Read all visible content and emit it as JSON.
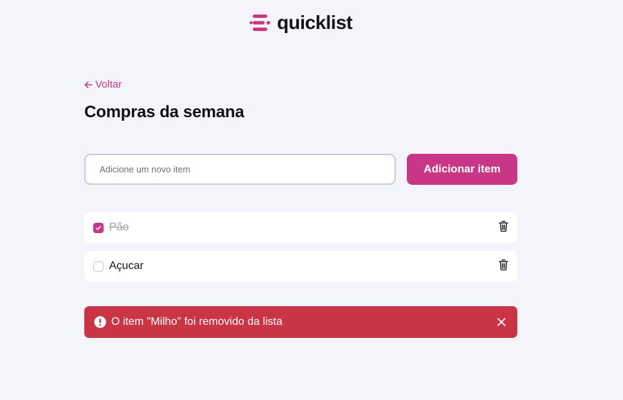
{
  "header": {
    "logo_text": "quicklist",
    "logo_icon": "list-logo-icon",
    "brand_color": "#c93686"
  },
  "nav": {
    "back_label": "Voltar",
    "back_icon": "arrow-left-icon"
  },
  "page": {
    "title": "Compras da semana"
  },
  "form": {
    "placeholder": "Adicione um novo item",
    "value": "",
    "add_label": "Adicionar item"
  },
  "items": [
    {
      "label": "Pão",
      "checked": true,
      "delete_icon": "trash-icon"
    },
    {
      "label": "Açucar",
      "checked": false,
      "delete_icon": "trash-icon"
    }
  ],
  "toast": {
    "message": "O item \"Milho\" foi removido da lista",
    "icon": "alert-circle-icon",
    "close_icon": "close-icon",
    "color": "#c93545"
  }
}
